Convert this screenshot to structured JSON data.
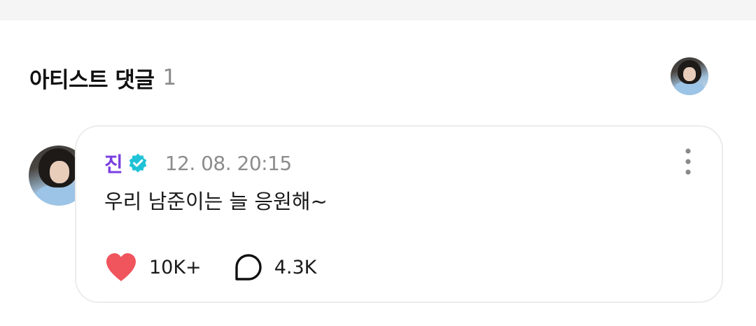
{
  "section": {
    "title": "아티스트 댓글",
    "count": "1"
  },
  "comment": {
    "author": "진",
    "verified": true,
    "timestamp": "12. 08. 20:15",
    "text": "우리 남준이는 늘 응원해~",
    "likes": "10K+",
    "replies": "4.3K"
  },
  "icons": {
    "header_avatar": "artist-avatar-icon",
    "comment_avatar": "author-avatar-icon",
    "verified": "verified-badge-icon",
    "more": "more-vertical-icon",
    "like": "heart-icon",
    "reply": "comment-bubble-icon"
  },
  "colors": {
    "author_name": "#7a3fe0",
    "verified_badge": "#1fc2d6",
    "heart": "#f0545d",
    "timestamp": "#8c8c8c",
    "count_muted": "#8a8a8a"
  }
}
